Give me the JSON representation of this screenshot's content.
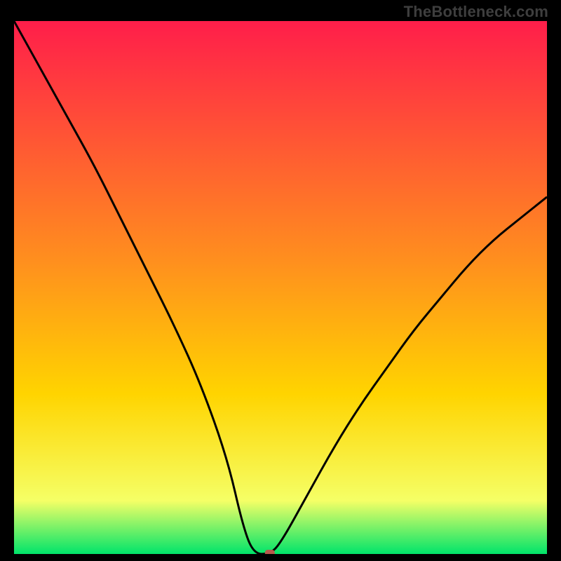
{
  "watermark": "TheBottleneck.com",
  "chart_data": {
    "type": "line",
    "title": "",
    "xlabel": "",
    "ylabel": "",
    "xlim": [
      0,
      100
    ],
    "ylim": [
      0,
      100
    ],
    "x": [
      0,
      5,
      10,
      15,
      20,
      25,
      30,
      35,
      40,
      43,
      45,
      48,
      50,
      55,
      60,
      65,
      70,
      75,
      80,
      85,
      90,
      95,
      100
    ],
    "y": [
      100,
      91,
      82,
      73,
      63,
      53,
      43,
      32,
      18,
      5,
      0,
      0,
      2,
      11,
      20,
      28,
      35,
      42,
      48,
      54,
      59,
      63,
      67
    ],
    "marker": {
      "x": 48,
      "y": 0
    },
    "colors": {
      "gradient_top": "#ff1e4a",
      "gradient_mid": "#ffd400",
      "gradient_bottom": "#00e46a",
      "curve": "#000000",
      "marker": "#b85a4c"
    }
  }
}
